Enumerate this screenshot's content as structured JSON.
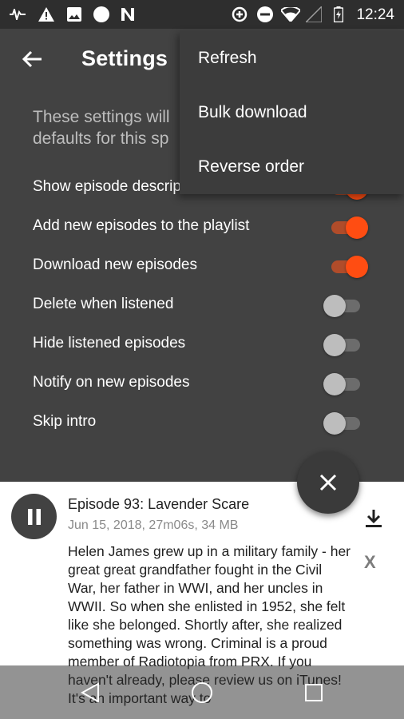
{
  "status_bar": {
    "time": "12:24",
    "icons": [
      "signal-scan-icon",
      "warning-icon",
      "image-icon",
      "circle-icon",
      "n-notification-icon",
      "data-saver-icon",
      "do-not-disturb-icon",
      "wifi-icon",
      "cell-signal-icon",
      "battery-charging-icon"
    ]
  },
  "app_bar": {
    "title": "Settings",
    "back_icon": "arrow-back-icon"
  },
  "settings": {
    "description": "These settings will override the global defaults for this sp",
    "items": [
      {
        "label": "Show episode descriptions",
        "on": true
      },
      {
        "label": "Add new episodes to the playlist",
        "on": true
      },
      {
        "label": "Download new episodes",
        "on": true
      },
      {
        "label": "Delete when listened",
        "on": false
      },
      {
        "label": "Hide listened episodes",
        "on": false
      },
      {
        "label": "Notify on new episodes",
        "on": false
      },
      {
        "label": "Skip intro",
        "on": false
      }
    ],
    "visible_labels": {
      "item0": "Show episode descrip",
      "desc_line1": "These settings will",
      "desc_line2": "defaults for this sp"
    }
  },
  "overflow_menu": {
    "items": [
      "Refresh",
      "Bulk download",
      "Reverse order"
    ]
  },
  "fab": {
    "icon": "close-icon"
  },
  "player": {
    "title": "Episode 93: Lavender Scare",
    "meta": "Jun 15, 2018, 27m06s, 34 MB",
    "description": "Helen James grew up in a military family - her great great grandfather fought in the Civil War, her father in WWI, and her uncles in WWII. So when she enlisted in 1952, she felt like she belonged. Shortly after, she realized something was wrong. Criminal is a proud member of Radiotopia from PRX. If you haven't already, please review us on iTunes! It's an important way to",
    "dismiss_label": "X"
  },
  "colors": {
    "accent": "#ff4d12",
    "background": "#424242",
    "menu": "#3c3c3c"
  }
}
